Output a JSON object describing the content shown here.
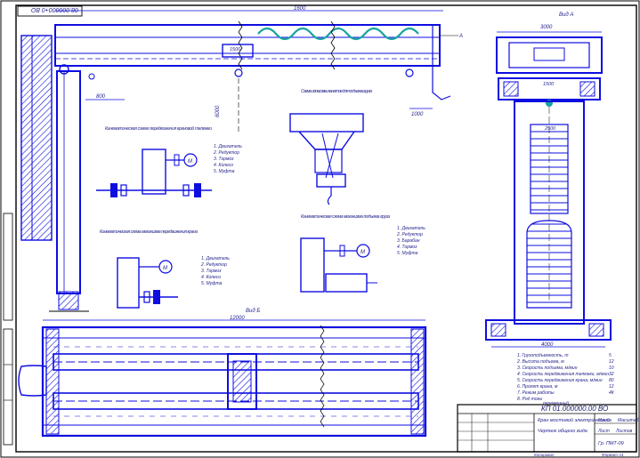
{
  "drawing": {
    "code_rotated": "08.000000+0 ВО",
    "code_main": "КП 01.000000.00 ВО",
    "title_line": "Кран мостовой электрический",
    "subtitle_line": "Чертеж общего вида",
    "group": "Гр. ПМТ-09",
    "sheet_label": "Лист",
    "sheets_label": "Листов",
    "mass_label": "Масса",
    "scale_label": "Масштаб",
    "footer_left": "Копировал",
    "footer_right": "Формат А1"
  },
  "views": {
    "view_a": "Вид А",
    "view_b": "Вид Б"
  },
  "dimensions": {
    "top_span": "12000",
    "left_height": "6000",
    "left_offset": "800",
    "trolley_width": "1500",
    "right_offset": "1000",
    "mid_marker": "1600",
    "view_a_top": "3000",
    "view_a_inner": "1500",
    "view_a_mid": "2500",
    "view_a_bottom": "4000",
    "view_b_span": "12000"
  },
  "schemes": {
    "bridge_travel": {
      "title": "Кинематическая схема передвижения крановой тележки",
      "items": [
        "1. Двигатель",
        "2. Редуктор",
        "3. Тормоз",
        "4. Колесо",
        "5. Муфта"
      ]
    },
    "crane_travel": {
      "title": "Кинематическая схема механизма передвижения крана",
      "items": [
        "1. Двигатель",
        "2. Редуктор",
        "3. Тормоз",
        "4. Колесо",
        "5. Муфта"
      ]
    },
    "hoist": {
      "title": "Кинематическая схема механизма подъема груза",
      "items": [
        "1. Двигатель",
        "2. Редуктор",
        "3. Барабан",
        "4. Тормоз",
        "5. Муфта"
      ]
    },
    "rope_reeving": {
      "title": "Схема запасовки канатов для подъема груза"
    }
  },
  "specifications": [
    {
      "label": "1. Грузоподъемность, т",
      "value": "5"
    },
    {
      "label": "2. Высота подъема, м",
      "value": "12"
    },
    {
      "label": "3. Скорость подъема, м/мин",
      "value": "10"
    },
    {
      "label": "4. Скорость передвижения тележки, м/мин",
      "value": "32"
    },
    {
      "label": "5. Скорость передвижения крана, м/мин",
      "value": "80"
    },
    {
      "label": "6. Пролет крана, м",
      "value": "12"
    },
    {
      "label": "7. Режим работы",
      "value": "4К"
    },
    {
      "label": "8. Род тока",
      "value": "переменный"
    }
  ],
  "colors": {
    "line": "#0d0de0",
    "hatch": "#0d0de0",
    "accent": "#1aa3a3",
    "frame": "#000000"
  }
}
